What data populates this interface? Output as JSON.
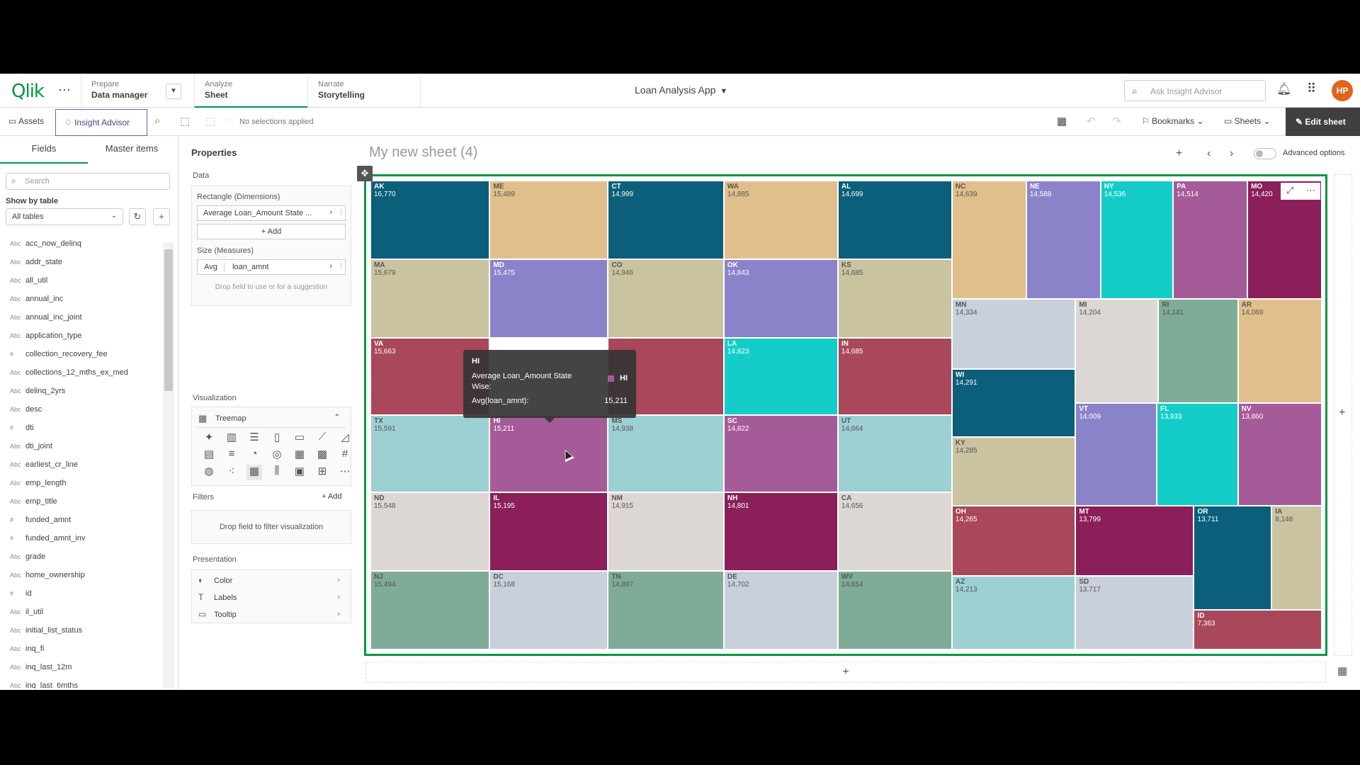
{
  "topbar": {
    "logo": "Qlik",
    "menu_dots": "···",
    "tabs": [
      {
        "small": "Prepare",
        "big": "Data manager"
      },
      {
        "small": "Analyze",
        "big": "Sheet"
      },
      {
        "small": "Narrate",
        "big": "Storytelling"
      }
    ],
    "app_title": "Loan Analysis App",
    "search_placeholder": "Ask Insight Advisor",
    "user_initials": "HP"
  },
  "toolbar": {
    "assets": "Assets",
    "insight_advisor": "Insight Advisor",
    "no_selections": "No selections applied",
    "bookmarks": "Bookmarks",
    "sheets": "Sheets",
    "edit_sheet": "Edit sheet"
  },
  "left_panel": {
    "tab_fields": "Fields",
    "tab_master": "Master items",
    "search_placeholder": "Search",
    "show_by_table": "Show by table",
    "table_select": "All tables",
    "fields": [
      {
        "type": "Abc",
        "name": "acc_now_delinq"
      },
      {
        "type": "Abc",
        "name": "addr_state"
      },
      {
        "type": "Abc",
        "name": "all_util"
      },
      {
        "type": "Abc",
        "name": "annual_inc"
      },
      {
        "type": "Abc",
        "name": "annual_inc_joint"
      },
      {
        "type": "Abc",
        "name": "application_type"
      },
      {
        "type": "#",
        "name": "collection_recovery_fee"
      },
      {
        "type": "Abc",
        "name": "collections_12_mths_ex_med"
      },
      {
        "type": "Abc",
        "name": "delinq_2yrs"
      },
      {
        "type": "Abc",
        "name": "desc"
      },
      {
        "type": "#",
        "name": "dti"
      },
      {
        "type": "Abc",
        "name": "dti_joint"
      },
      {
        "type": "Abc",
        "name": "earliest_cr_line"
      },
      {
        "type": "Abc",
        "name": "emp_length"
      },
      {
        "type": "Abc",
        "name": "emp_title"
      },
      {
        "type": "#",
        "name": "funded_amnt"
      },
      {
        "type": "#",
        "name": "funded_amnt_inv"
      },
      {
        "type": "Abc",
        "name": "grade"
      },
      {
        "type": "Abc",
        "name": "home_ownership"
      },
      {
        "type": "#",
        "name": "id"
      },
      {
        "type": "Abc",
        "name": "il_util"
      },
      {
        "type": "Abc",
        "name": "initial_list_status"
      },
      {
        "type": "Abc",
        "name": "inq_fi"
      },
      {
        "type": "Abc",
        "name": "inq_last_12m"
      },
      {
        "type": "Abc",
        "name": "inq_last_6mths"
      }
    ]
  },
  "properties": {
    "title": "Properties",
    "data_label": "Data",
    "dimensions_label": "Rectangle (Dimensions)",
    "dimension_value": "Average Loan_Amount State ...",
    "add_label": "Add",
    "measures_label": "Size (Measures)",
    "measure_agg": "Avg",
    "measure_field": "loan_amnt",
    "drop_hint": "Drop field to use or for a suggestion",
    "visualization_label": "Visualization",
    "visualization_type": "Treemap",
    "filters_label": "Filters",
    "filters_add": "Add",
    "filters_drop": "Drop field to filter visualization",
    "presentation_label": "Presentation",
    "presentation_items": [
      "Color",
      "Labels",
      "Tooltip"
    ]
  },
  "sheet": {
    "title": "My new sheet (4)",
    "advanced_options": "Advanced options"
  },
  "tooltip": {
    "header": "HI",
    "dimension_label": "Average Loan_Amount State Wise:",
    "dimension_value": "HI",
    "measure_label": "Avg(loan_amnt):",
    "measure_value": "15,211"
  },
  "chart_data": {
    "type": "treemap",
    "dimension": "Average Loan_Amount State Wise",
    "measure": "Avg(loan_amnt)",
    "items": [
      {
        "state": "AK",
        "value": 16770,
        "color": "#0b5f7a"
      },
      {
        "state": "ME",
        "value": 15489,
        "color": "#e0bf8c"
      },
      {
        "state": "CT",
        "value": 14999,
        "color": "#0b5f7a"
      },
      {
        "state": "WA",
        "value": 14885,
        "color": "#e0bf8c"
      },
      {
        "state": "AL",
        "value": 14699,
        "color": "#0b5f7a"
      },
      {
        "state": "NC",
        "value": 14639,
        "color": "#e0bf8c"
      },
      {
        "state": "NE",
        "value": 14588,
        "color": "#8b83c9"
      },
      {
        "state": "NY",
        "value": 14536,
        "color": "#14cdc8"
      },
      {
        "state": "PA",
        "value": 14514,
        "color": "#a65b99"
      },
      {
        "state": "MO",
        "value": 14420,
        "color": "#8a1f5a"
      },
      {
        "state": "MA",
        "value": 15679,
        "color": "#c9c3a0"
      },
      {
        "state": "MD",
        "value": 15475,
        "color": "#8b83c9"
      },
      {
        "state": "CO",
        "value": 14946,
        "color": "#c9c3a0"
      },
      {
        "state": "OK",
        "value": 14843,
        "color": "#8b83c9"
      },
      {
        "state": "KS",
        "value": 14685,
        "color": "#c9c3a0"
      },
      {
        "state": "MN",
        "value": 14334,
        "color": "#c8d0dc"
      },
      {
        "state": "MI",
        "value": 14204,
        "color": "#dcd7d3"
      },
      {
        "state": "RI",
        "value": 14141,
        "color": "#7fac96"
      },
      {
        "state": "AR",
        "value": 14069,
        "color": "#e0bf8c"
      },
      {
        "state": "VA",
        "value": 15663,
        "color": "#a8485a"
      },
      {
        "state": "WI",
        "value": 14291,
        "color": "#0b5f7a"
      },
      {
        "state": "LA",
        "value": 14823,
        "color": "#14cdc8"
      },
      {
        "state": "IN",
        "value": 14685,
        "color": "#a8485a"
      },
      {
        "state": "TX",
        "value": 15591,
        "color": "#9dd0d3"
      },
      {
        "state": "HI",
        "value": 15211,
        "color": "#a65b99"
      },
      {
        "state": "MS",
        "value": 14938,
        "color": "#9dd0d3"
      },
      {
        "state": "SC",
        "value": 14822,
        "color": "#a65b99"
      },
      {
        "state": "UT",
        "value": 14664,
        "color": "#9dd0d3"
      },
      {
        "state": "KY",
        "value": 14285,
        "color": "#c9c3a0"
      },
      {
        "state": "VT",
        "value": 14009,
        "color": "#8b83c9"
      },
      {
        "state": "FL",
        "value": 13933,
        "color": "#14cdc8"
      },
      {
        "state": "NV",
        "value": 13860,
        "color": "#a65b99"
      },
      {
        "state": "ND",
        "value": 15548,
        "color": "#dcd7d3"
      },
      {
        "state": "IL",
        "value": 15195,
        "color": "#8a1f5a"
      },
      {
        "state": "NM",
        "value": 14915,
        "color": "#dcd7d3"
      },
      {
        "state": "NH",
        "value": 14801,
        "color": "#8a1f5a"
      },
      {
        "state": "CA",
        "value": 14656,
        "color": "#dcd7d3"
      },
      {
        "state": "OH",
        "value": 14265,
        "color": "#a8485a"
      },
      {
        "state": "MT",
        "value": 13799,
        "color": "#8a1f5a"
      },
      {
        "state": "OR",
        "value": 13711,
        "color": "#0b5f7a"
      },
      {
        "state": "IA",
        "value": 8148,
        "color": "#c9c3a0"
      },
      {
        "state": "NJ",
        "value": 15494,
        "color": "#7fac96"
      },
      {
        "state": "DC",
        "value": 15168,
        "color": "#c8d0dc"
      },
      {
        "state": "TN",
        "value": 14897,
        "color": "#7fac96"
      },
      {
        "state": "DE",
        "value": 14702,
        "color": "#c8d0dc"
      },
      {
        "state": "WV",
        "value": 14654,
        "color": "#7fac96"
      },
      {
        "state": "AZ",
        "value": 14213,
        "color": "#9dd0d3"
      },
      {
        "state": "SD",
        "value": 13717,
        "color": "#c8d0dc"
      },
      {
        "state": "ID",
        "value": 7363,
        "color": "#a8485a"
      }
    ]
  }
}
